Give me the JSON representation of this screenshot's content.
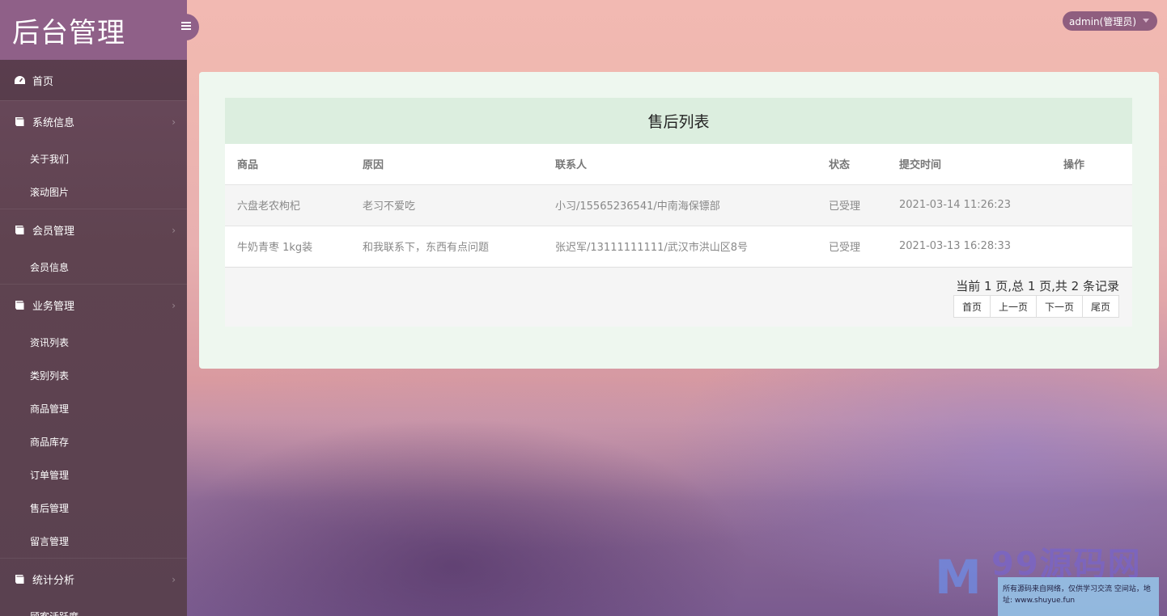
{
  "brand": {
    "title": "后台管理"
  },
  "user": {
    "name": "admin(管理员)"
  },
  "sidebar": {
    "home": "首页",
    "groups": [
      {
        "label": "系统信息",
        "children": [
          "关于我们",
          "滚动图片"
        ]
      },
      {
        "label": "会员管理",
        "children": [
          "会员信息"
        ]
      },
      {
        "label": "业务管理",
        "children": [
          "资讯列表",
          "类别列表",
          "商品管理",
          "商品库存",
          "订单管理",
          "售后管理",
          "留言管理"
        ]
      },
      {
        "label": "统计分析",
        "children": [
          "顾客活跃度"
        ]
      }
    ]
  },
  "table": {
    "title": "售后列表",
    "columns": [
      "商品",
      "原因",
      "联系人",
      "状态",
      "提交时间",
      "操作"
    ],
    "rows": [
      [
        "六盘老农枸杞",
        "老习不爱吃",
        "小习/15565236541/中南海保镖部",
        "已受理",
        "2021-03-14 11:26:23",
        ""
      ],
      [
        "牛奶青枣 1kg装",
        "和我联系下，东西有点问题",
        "张迟军/13111111111/武汉市洪山区8号",
        "已受理",
        "2021-03-13 16:28:33",
        ""
      ]
    ]
  },
  "pager": {
    "info": "当前 1 页,总 1 页,共 2 条记录",
    "first": "首页",
    "prev": "上一页",
    "next": "下一页",
    "last": "尾页"
  },
  "watermark": {
    "text": "99源码网",
    "note": "所有源码来自网络，仅供学习交流 空间站，地址: www.shuyue.fun"
  },
  "colors": {
    "sidebar_header": "#8f6088",
    "sidebar_bg": "#5f4350",
    "panel_bg": "#eef7ef",
    "table_title_bg": "#dceedf"
  }
}
